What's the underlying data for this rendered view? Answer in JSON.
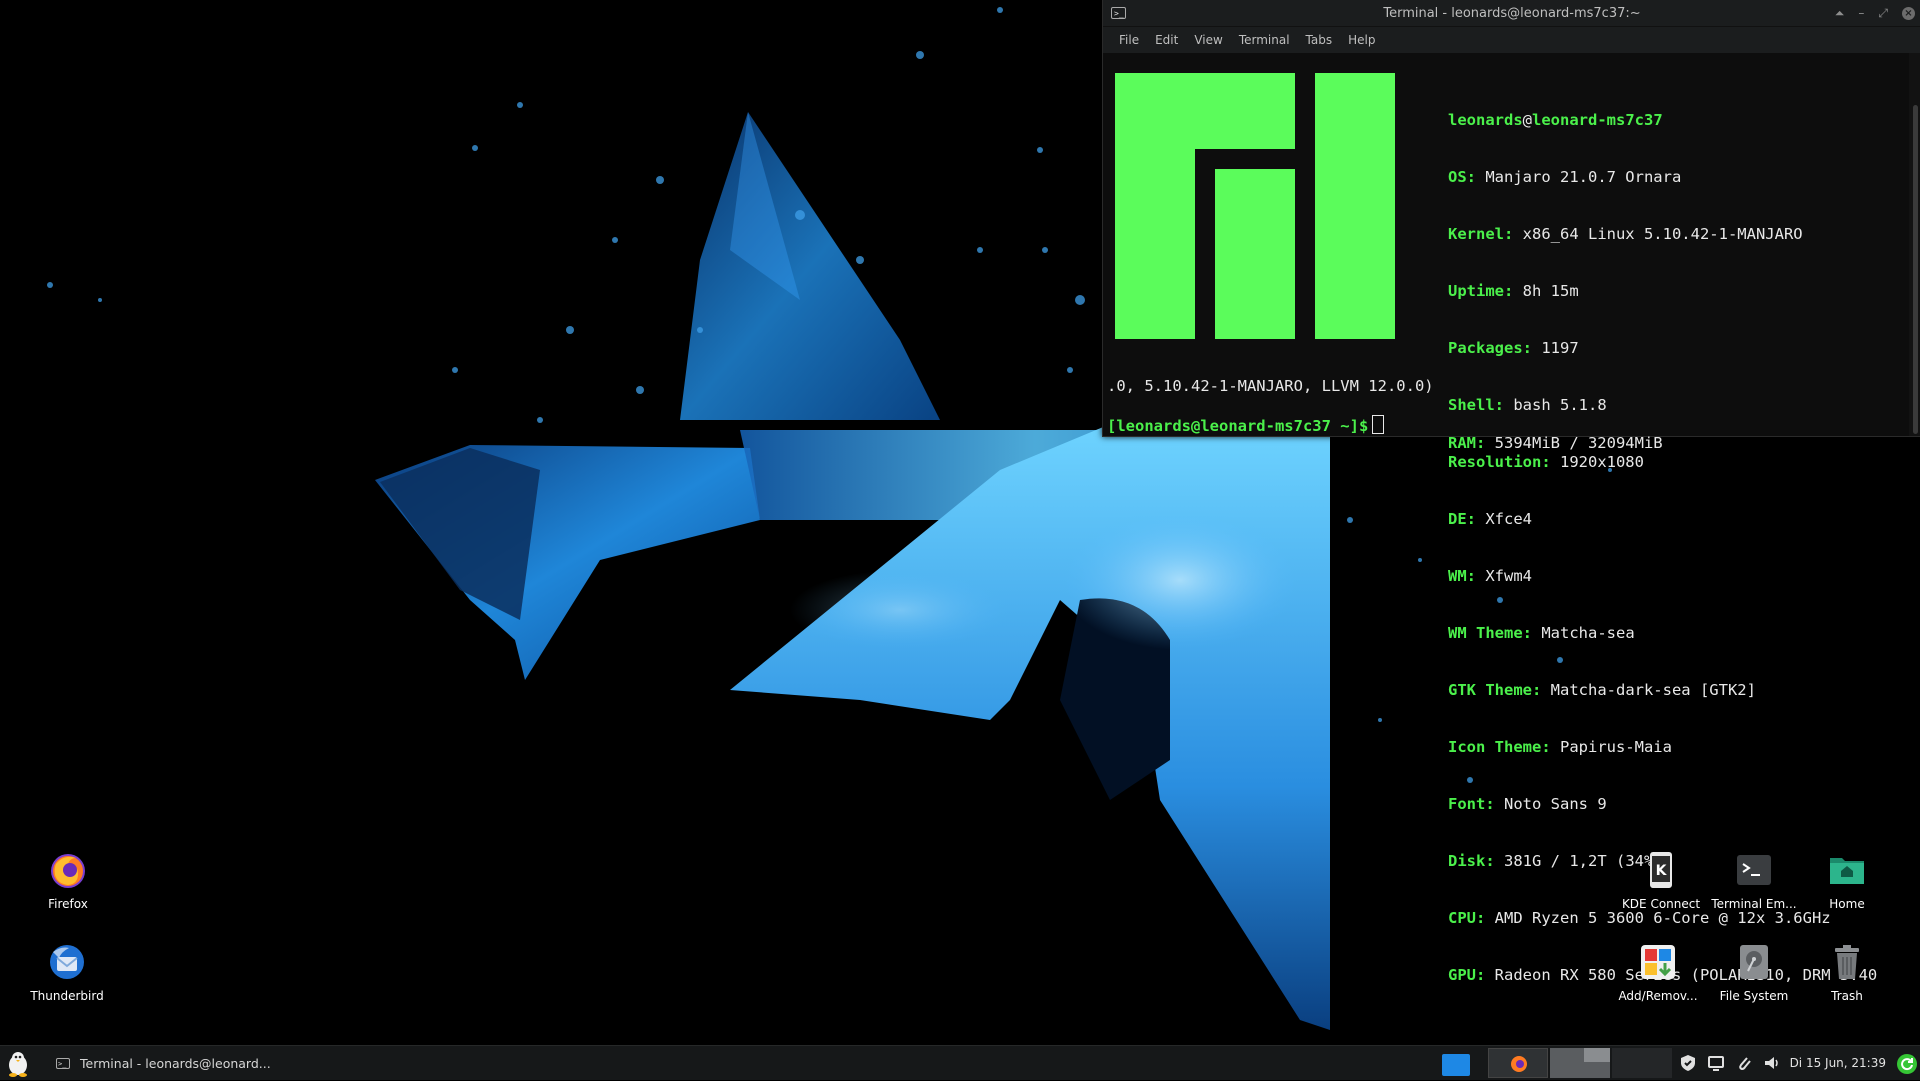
{
  "terminal": {
    "title": "Terminal - leonards@leonard-ms7c37:~",
    "menu": [
      "File",
      "Edit",
      "View",
      "Terminal",
      "Tabs",
      "Help"
    ],
    "header_user": "leonards",
    "header_at": "@",
    "header_host": "leonard-ms7c37",
    "info": [
      {
        "key": "OS:",
        "value": " Manjaro 21.0.7 Ornara"
      },
      {
        "key": "Kernel:",
        "value": " x86_64 Linux 5.10.42-1-MANJARO"
      },
      {
        "key": "Uptime:",
        "value": " 8h 15m"
      },
      {
        "key": "Packages:",
        "value": " 1197"
      },
      {
        "key": "Shell:",
        "value": " bash 5.1.8"
      },
      {
        "key": "Resolution:",
        "value": " 1920x1080"
      },
      {
        "key": "DE:",
        "value": " Xfce4"
      },
      {
        "key": "WM:",
        "value": " Xfwm4"
      },
      {
        "key": "WM Theme:",
        "value": " Matcha-sea"
      },
      {
        "key": "GTK Theme:",
        "value": " Matcha-dark-sea [GTK2]"
      },
      {
        "key": "Icon Theme:",
        "value": " Papirus-Maia"
      },
      {
        "key": "Font:",
        "value": " Noto Sans 9"
      },
      {
        "key": "Disk:",
        "value": " 381G / 1,2T (34%)"
      },
      {
        "key": "CPU:",
        "value": " AMD Ryzen 5 3600 6-Core @ 12x 3.6GHz"
      },
      {
        "key": "GPU:",
        "value": " Radeon RX 580 Series (POLARIS10, DRM 3.40"
      }
    ],
    "gpu_wrap": ".0, 5.10.42-1-MANJARO, LLVM 12.0.0)",
    "ram_key": "RAM:",
    "ram_value": " 5394MiB / 32094MiB",
    "prompt": "[leonards@leonard-ms7c37 ~]$"
  },
  "desktop_icons": {
    "firefox": "Firefox",
    "thunderbird": "Thunderbird",
    "kde_connect": "KDE Connect",
    "terminal": "Terminal Em...",
    "home": "Home",
    "add_remove": "Add/Remov...",
    "file_system": "File System",
    "trash": "Trash"
  },
  "panel": {
    "task_label": "Terminal - leonards@leonard...",
    "clock": "Di 15 Jun, 21:39"
  },
  "colors": {
    "terminal_green": "#4bf04b",
    "manjaro_logo": "#5bfc5b",
    "panel_bg": "#161819",
    "accent_blue": "#1e88e5"
  }
}
